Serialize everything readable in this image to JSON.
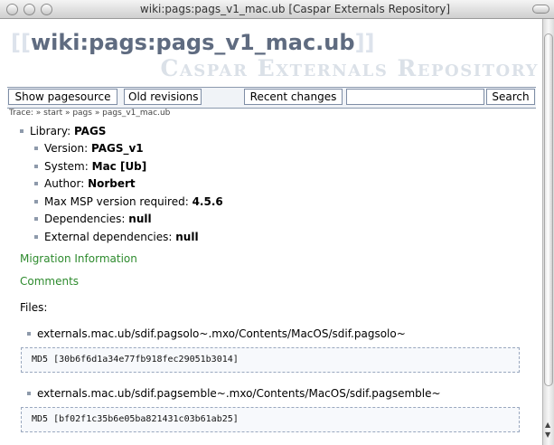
{
  "window": {
    "title": "wiki:pags:pags_v1_mac.ub [Caspar Externals Repository]"
  },
  "header": {
    "page_title": "wiki:pags:pags_v1_mac.ub",
    "bracket_open": "[[",
    "bracket_close": "]]",
    "site_title": "Caspar Externals Repository"
  },
  "toolbar": {
    "show_pagesource": "Show pagesource",
    "old_revisions": "Old revisions",
    "recent_changes": "Recent changes",
    "search_value": "",
    "search": "Search"
  },
  "breadcrumb": "Trace: » start » pags » pags_v1_mac.ub",
  "library": {
    "label": "Library:",
    "value": "PAGS",
    "attributes": [
      {
        "label": "Version:",
        "value": "PAGS_v1"
      },
      {
        "label": "System:",
        "value": "Mac [Ub]"
      },
      {
        "label": "Author:",
        "value": "Norbert"
      },
      {
        "label": "Max MSP version required:",
        "value": "4.5.6"
      },
      {
        "label": "Dependencies:",
        "value": "null"
      },
      {
        "label": "External dependencies:",
        "value": "null"
      }
    ]
  },
  "links": {
    "migration": "Migration Information",
    "comments": "Comments"
  },
  "files": {
    "heading": "Files:",
    "entries": [
      {
        "path": "externals.mac.ub/sdif.pagsolo~.mxo/Contents/MacOS/sdif.pagsolo~",
        "md5": "MD5 [30b6f6d1a34e77fb918fec29051b3014]"
      },
      {
        "path": "externals.mac.ub/sdif.pagsemble~.mxo/Contents/MacOS/sdif.pagsemble~",
        "md5": "MD5 [bf02f1c35b6e05ba821431c03b61ab25]"
      }
    ]
  },
  "colors": {
    "link": "#2e8b2e",
    "title": "#5f6b80",
    "site_title": "#dbe1e8"
  },
  "icons": [
    "close-light-icon",
    "minimize-light-icon",
    "zoom-light-icon",
    "toolbar-toggle-icon",
    "scroll-up-arrow-icon",
    "scroll-down-arrow-icon"
  ]
}
